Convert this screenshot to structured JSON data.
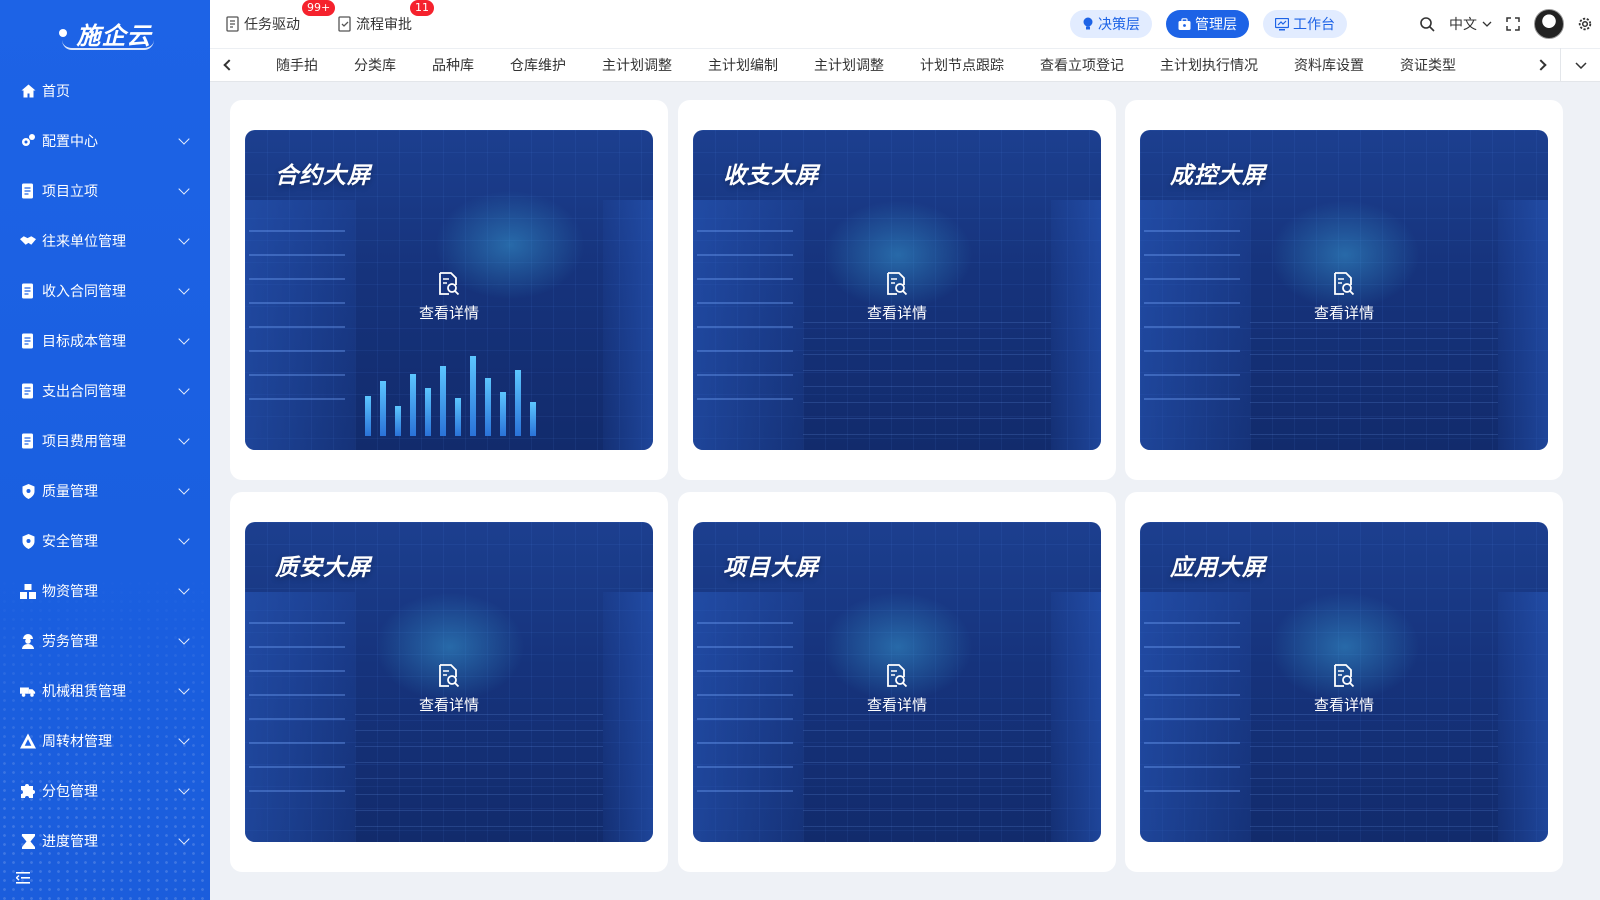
{
  "app": {
    "logo": "施企云"
  },
  "sidebar": {
    "items": [
      {
        "label": "首页",
        "icon": "home-icon",
        "expandable": false
      },
      {
        "label": "配置中心",
        "icon": "gears-icon",
        "expandable": true
      },
      {
        "label": "项目立项",
        "icon": "document-icon",
        "expandable": true
      },
      {
        "label": "往来单位管理",
        "icon": "handshake-icon",
        "expandable": true
      },
      {
        "label": "收入合同管理",
        "icon": "contract-icon",
        "expandable": true
      },
      {
        "label": "目标成本管理",
        "icon": "cost-icon",
        "expandable": true
      },
      {
        "label": "支出合同管理",
        "icon": "payment-icon",
        "expandable": true
      },
      {
        "label": "项目费用管理",
        "icon": "expense-icon",
        "expandable": true
      },
      {
        "label": "质量管理",
        "icon": "quality-shield-icon",
        "expandable": true
      },
      {
        "label": "安全管理",
        "icon": "safety-shield-icon",
        "expandable": true
      },
      {
        "label": "物资管理",
        "icon": "boxes-icon",
        "expandable": true
      },
      {
        "label": "劳务管理",
        "icon": "worker-icon",
        "expandable": true
      },
      {
        "label": "机械租赁管理",
        "icon": "truck-icon",
        "expandable": true
      },
      {
        "label": "周转材管理",
        "icon": "scaffold-icon",
        "expandable": true
      },
      {
        "label": "分包管理",
        "icon": "puzzle-icon",
        "expandable": true
      },
      {
        "label": "进度管理",
        "icon": "hourglass-icon",
        "expandable": true
      }
    ]
  },
  "topbar": {
    "task_label": "任务驱动",
    "task_badge": "99+",
    "approval_label": "流程审批",
    "approval_badge": "11",
    "roles": [
      "决策层",
      "管理层",
      "工作台"
    ],
    "language": "中文"
  },
  "tabs": [
    "随手拍",
    "分类库",
    "品种库",
    "仓库维护",
    "主计划调整",
    "主计划编制",
    "主计划调整",
    "计划节点跟踪",
    "查看立项登记",
    "主计划执行情况",
    "资料库设置",
    "资证类型"
  ],
  "cards": [
    {
      "title": "合约大屏",
      "action": "查看详情"
    },
    {
      "title": "收支大屏",
      "action": "查看详情"
    },
    {
      "title": "成控大屏",
      "action": "查看详情"
    },
    {
      "title": "质安大屏",
      "action": "查看详情"
    },
    {
      "title": "项目大屏",
      "action": "查看详情"
    },
    {
      "title": "应用大屏",
      "action": "查看详情"
    }
  ],
  "colors": {
    "primary": "#1d63e6",
    "badge": "#f5222d",
    "screen_bg": "#16337c"
  }
}
